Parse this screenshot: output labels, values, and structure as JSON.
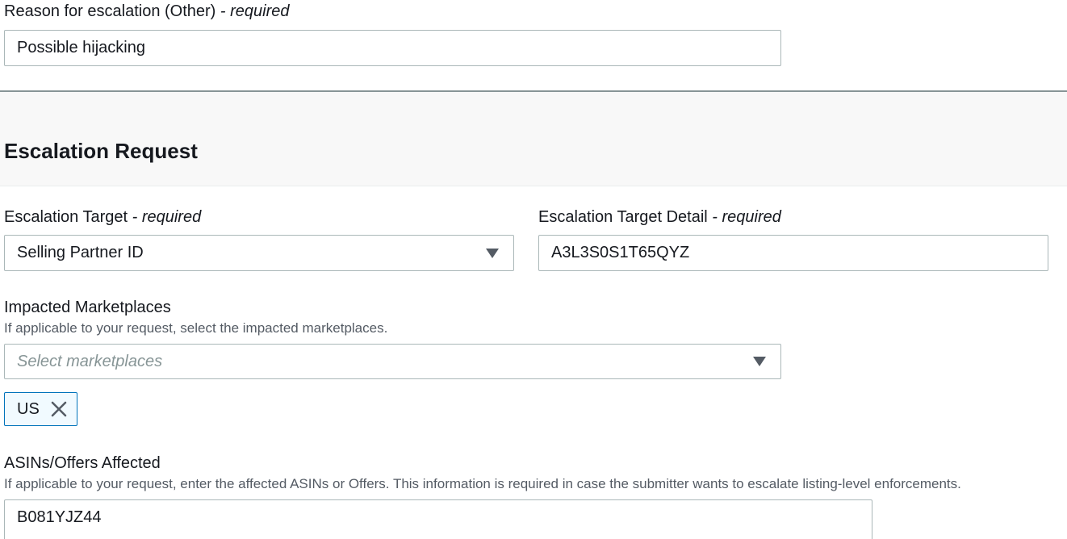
{
  "reason": {
    "label": "Reason for escalation (Other)",
    "required": " - required",
    "value": "Possible hijacking"
  },
  "section": {
    "title": "Escalation Request"
  },
  "escalation_target": {
    "label": "Escalation Target",
    "required": " - required",
    "value": "Selling Partner ID"
  },
  "escalation_target_detail": {
    "label": "Escalation Target Detail",
    "required": " - required",
    "value": "A3L3S0S1T65QYZ"
  },
  "marketplaces": {
    "label": "Impacted Marketplaces",
    "hint": "If applicable to your request, select the impacted marketplaces.",
    "placeholder": "Select marketplaces",
    "selected": [
      "US"
    ]
  },
  "asins": {
    "label": "ASINs/Offers Affected",
    "hint": "If applicable to your request, enter the affected ASINs or Offers. This information is required in case the submitter wants to escalate listing-level enforcements.",
    "value": "B081YJZ44"
  },
  "icons": {
    "dropdown": "caret-down-icon",
    "remove": "close-icon"
  }
}
